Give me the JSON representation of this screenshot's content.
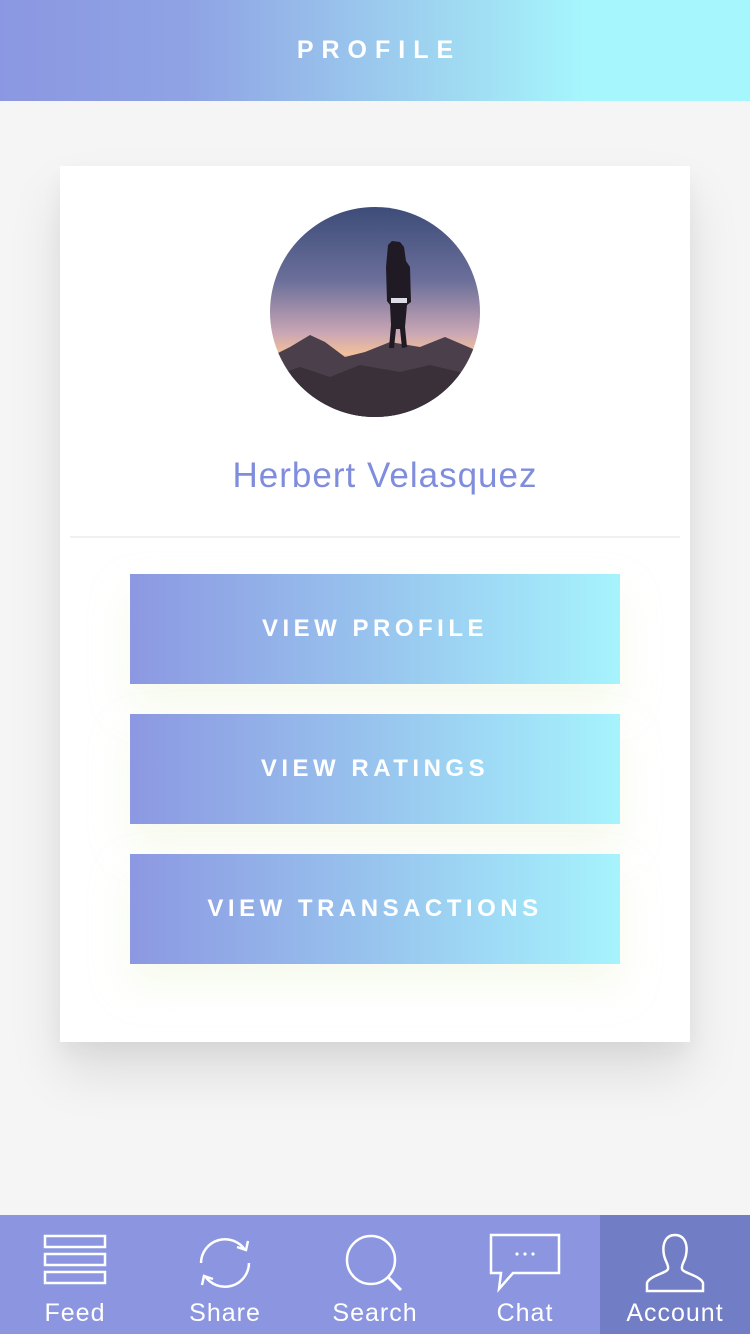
{
  "header": {
    "title": "PROFILE"
  },
  "profile": {
    "name": "Herbert Velasquez",
    "avatar_icon": "user-photo"
  },
  "actions": [
    {
      "label": "VIEW PROFILE"
    },
    {
      "label": "VIEW RATINGS"
    },
    {
      "label": "VIEW TRANSACTIONS"
    }
  ],
  "tabbar": {
    "items": [
      {
        "label": "Feed",
        "icon": "feed-icon"
      },
      {
        "label": "Share",
        "icon": "share-icon"
      },
      {
        "label": "Search",
        "icon": "search-icon"
      },
      {
        "label": "Chat",
        "icon": "chat-icon"
      },
      {
        "label": "Account",
        "icon": "account-icon"
      }
    ],
    "active": "Account"
  },
  "colors": {
    "accent": "#8b95e0",
    "accent_active": "#717dc4",
    "gradient_end": "#a6f6fd",
    "name_text": "#7f8ddc"
  }
}
